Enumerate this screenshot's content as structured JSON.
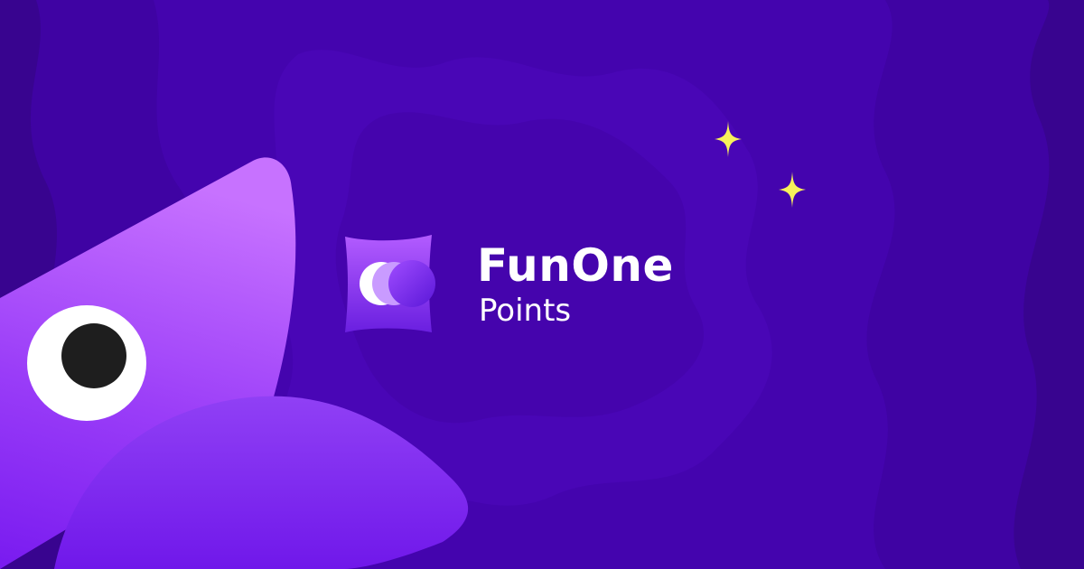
{
  "brand": {
    "name": "FunOne",
    "subtitle": "Points"
  },
  "colors": {
    "background": "#3a0594",
    "background_mid": "#4300a8",
    "background_light": "#4a05b8",
    "mascot_light": "#c772ff",
    "mascot_dark": "#7a1cf0",
    "sparkle": "#f7f25a",
    "text": "#ffffff"
  },
  "icons": {
    "logo": "funone-logo-icon",
    "sparkles": [
      "sparkle-icon",
      "sparkle-icon"
    ],
    "mascot": "mascot-creature"
  }
}
